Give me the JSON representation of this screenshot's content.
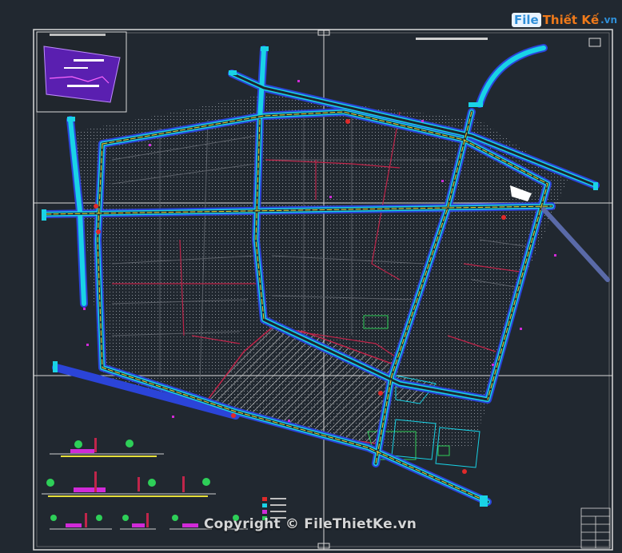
{
  "brand": {
    "logo_part1": "File",
    "logo_part2": "Thiết Kế",
    "logo_part3": ".vn"
  },
  "watermark": {
    "text": "Copyright © FileThietKe.vn"
  },
  "colors": {
    "background": "#212830",
    "frame": "#d9d9d9",
    "road_cyan": "#19d3e6",
    "road_yellow": "#e8e03a",
    "road_blue": "#2b44d8",
    "lot_red": "#c0254a",
    "lot_magenta": "#d12ad8",
    "hatch": "#c7c7c7",
    "block_gray": "#5b6068",
    "keymap_purple": "#5a1fb0"
  }
}
